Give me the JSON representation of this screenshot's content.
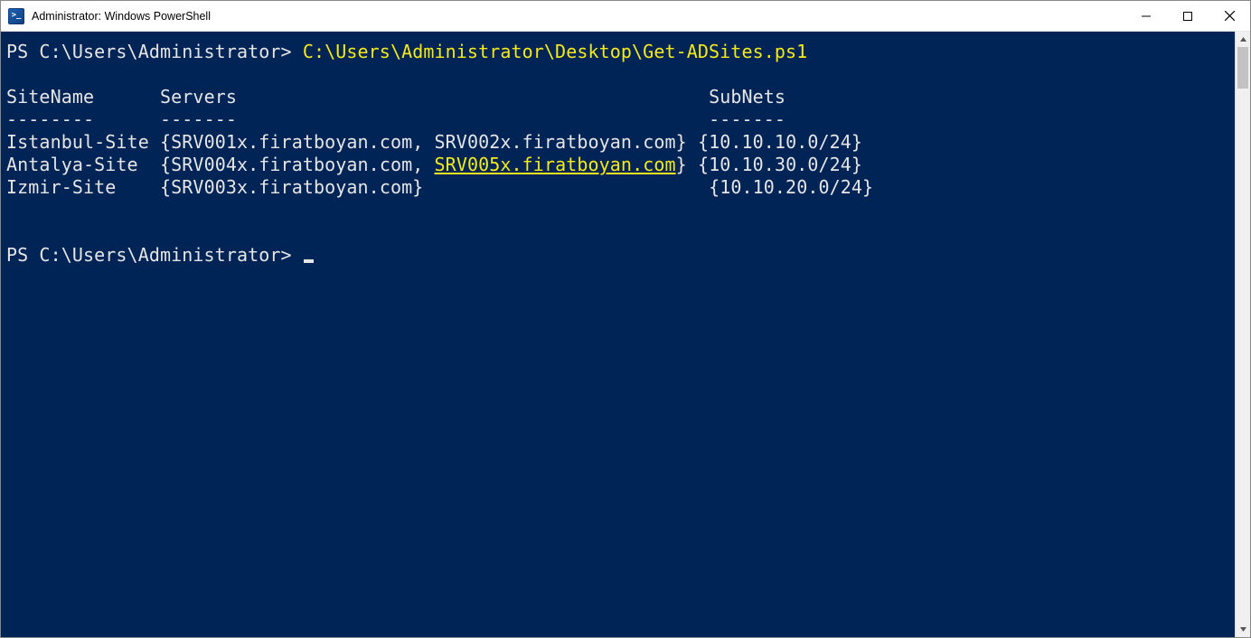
{
  "window": {
    "title": "Administrator: Windows PowerShell"
  },
  "prompt1_prefix": "PS C:\\Users\\Administrator> ",
  "prompt1_cmd": "C:\\Users\\Administrator\\Desktop\\Get-ADSites.ps1",
  "header_siteName": "SiteName",
  "header_servers": "Servers",
  "header_subnets": "SubNets",
  "dash_siteName": "--------",
  "dash_servers": "-------",
  "dash_subnets": "-------",
  "rows": [
    {
      "site": "Istanbul-Site",
      "servers_text": "{SRV001x.firatboyan.com, SRV002x.firatboyan.com}",
      "subnets_text": "{10.10.10.0/24}"
    },
    {
      "site": "Antalya-Site",
      "servers_prefix": "{SRV004x.firatboyan.com, ",
      "servers_highlight": "SRV005x.firatboyan.com",
      "servers_suffix": "}",
      "subnets_text": "{10.10.30.0/24}"
    },
    {
      "site": "Izmir-Site",
      "servers_text": "{SRV003x.firatboyan.com}",
      "subnets_text": "{10.10.20.0/24}"
    }
  ],
  "prompt2_prefix": "PS C:\\Users\\Administrator> "
}
